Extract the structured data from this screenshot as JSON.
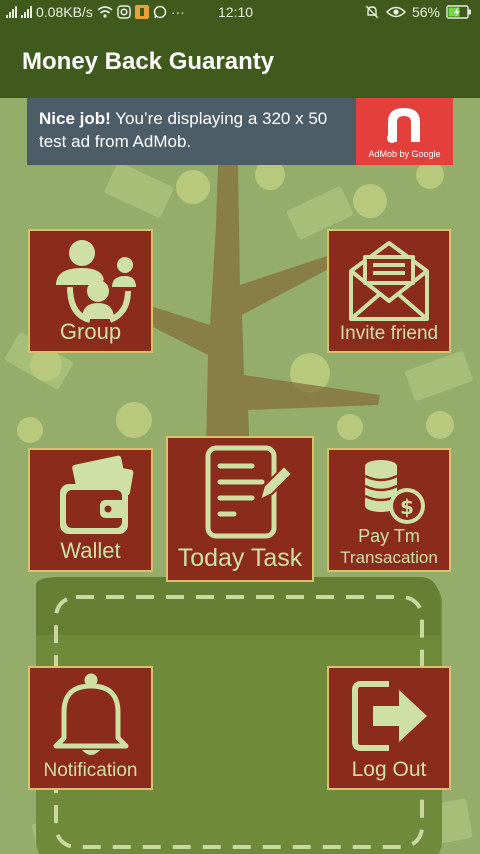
{
  "status_bar": {
    "speed": "0.08KB/s",
    "time": "12:10",
    "battery": "56%",
    "dots": "···"
  },
  "app_bar": {
    "title": "Money Back Guaranty"
  },
  "ad_banner": {
    "headline": "Nice job!",
    "body": " You’re displaying a 320 x 50 test ad from AdMob.",
    "brand": "AdMob by Google"
  },
  "tiles": {
    "group": "Group",
    "invite": "Invite friend",
    "wallet": "Wallet",
    "today_task": "Today Task",
    "paytm_line1": "Pay Tm",
    "paytm_line2": "Transacation",
    "notification": "Notification",
    "logout": "Log Out"
  },
  "colors": {
    "app_bar": "#3f5a1c",
    "tile_bg": "#8a2b1c",
    "tile_border": "#d9c06a",
    "tile_icon": "#cfe0a5",
    "background": "#94ad6a",
    "ad_bg": "#4c5d68",
    "admob_red": "#e4403b"
  }
}
